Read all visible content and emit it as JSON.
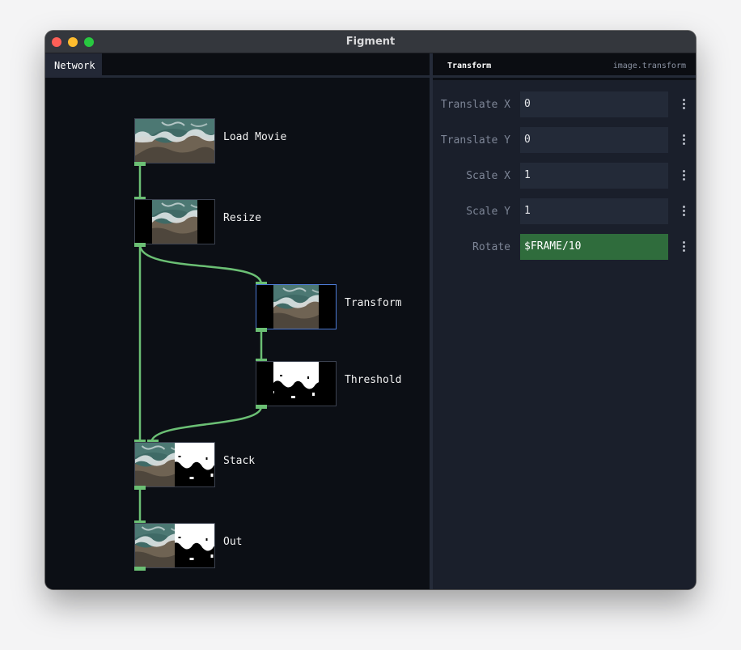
{
  "window": {
    "title": "Figment"
  },
  "network_panel": {
    "tab_label": "Network",
    "nodes": [
      {
        "id": "load-movie",
        "label": "Load Movie",
        "selected": false
      },
      {
        "id": "resize",
        "label": "Resize",
        "selected": false
      },
      {
        "id": "transform",
        "label": "Transform",
        "selected": true
      },
      {
        "id": "threshold",
        "label": "Threshold",
        "selected": false
      },
      {
        "id": "stack",
        "label": "Stack",
        "selected": false
      },
      {
        "id": "out",
        "label": "Out",
        "selected": false
      }
    ],
    "connections": [
      [
        "load-movie",
        "resize"
      ],
      [
        "resize",
        "transform"
      ],
      [
        "resize",
        "stack"
      ],
      [
        "transform",
        "threshold"
      ],
      [
        "threshold",
        "stack"
      ],
      [
        "stack",
        "out"
      ]
    ]
  },
  "inspector": {
    "title": "Transform",
    "type": "image.transform",
    "params": [
      {
        "label": "Translate X",
        "value": "0",
        "is_expression": false
      },
      {
        "label": "Translate Y",
        "value": "0",
        "is_expression": false
      },
      {
        "label": "Scale X",
        "value": "1",
        "is_expression": false
      },
      {
        "label": "Scale Y",
        "value": "1",
        "is_expression": false
      },
      {
        "label": "Rotate",
        "value": "$FRAME/10",
        "is_expression": true
      }
    ]
  },
  "colors": {
    "accent_green": "#6bbf74",
    "expression_field": "#2f6c3c",
    "selected_node_border": "#4c79d2"
  },
  "icons": {
    "param_menu": "kebab-menu-icon"
  }
}
